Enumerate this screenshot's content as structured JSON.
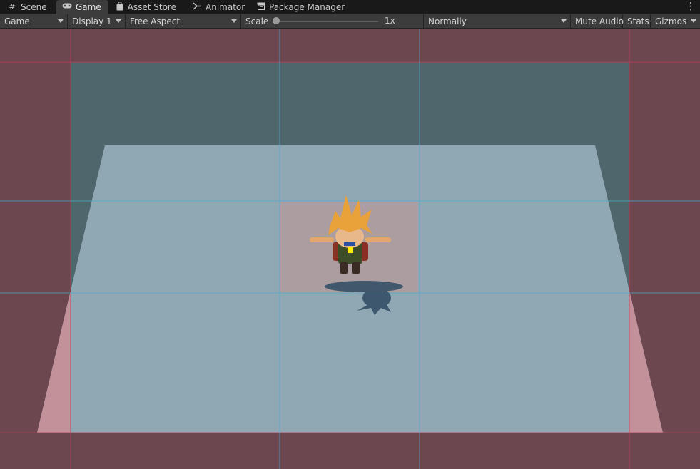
{
  "tabs": [
    {
      "label": "Scene",
      "icon": "grid-icon",
      "active": false
    },
    {
      "label": "Game",
      "icon": "gamepad-icon",
      "active": true
    },
    {
      "label": "Asset Store",
      "icon": "bag-icon",
      "active": false
    },
    {
      "label": "Animator",
      "icon": "animator-icon",
      "active": false
    },
    {
      "label": "Package Manager",
      "icon": "package-icon",
      "active": false
    }
  ],
  "toolbar": {
    "view_mode": "Game",
    "display": "Display 1",
    "aspect": "Free Aspect",
    "scale_label": "Scale",
    "scale_value": "1x",
    "scale_fraction": 0.0,
    "play_mode": "Normally",
    "mute_audio": "Mute Audio",
    "stats": "Stats",
    "gizmos": "Gizmos"
  },
  "colors": {
    "tab_bar": "#191919",
    "toolbar": "#3c3c3c",
    "outer_zone": "#6c474f",
    "sky_zone": "#4f666c",
    "ground": "#8fa8b3",
    "player_marker": "#ffee00"
  }
}
